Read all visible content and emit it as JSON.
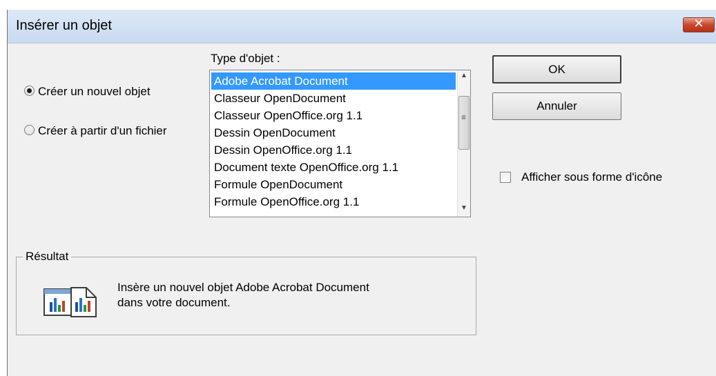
{
  "window": {
    "title": "Insérer un objet",
    "close_glyph": "✕"
  },
  "options": {
    "create_new_label": "Créer un nouvel objet",
    "create_new_checked": true,
    "create_from_file_label": "Créer à partir d'un fichier",
    "create_from_file_checked": false
  },
  "object_type": {
    "label": "Type d'objet :",
    "selected_index": 0,
    "items": [
      "Adobe Acrobat Document",
      "Classeur OpenDocument",
      "Classeur OpenOffice.org 1.1",
      "Dessin OpenDocument",
      "Dessin OpenOffice.org 1.1",
      "Document texte OpenOffice.org 1.1",
      "Formule OpenDocument",
      "Formule OpenOffice.org 1.1"
    ]
  },
  "buttons": {
    "ok_label": "OK",
    "cancel_label": "Annuler"
  },
  "display_as_icon": {
    "label": "Afficher sous forme d'icône",
    "checked": false
  },
  "result": {
    "legend": "Résultat",
    "line1": "Insère un nouvel objet Adobe Acrobat Document",
    "line2": "dans votre document."
  }
}
